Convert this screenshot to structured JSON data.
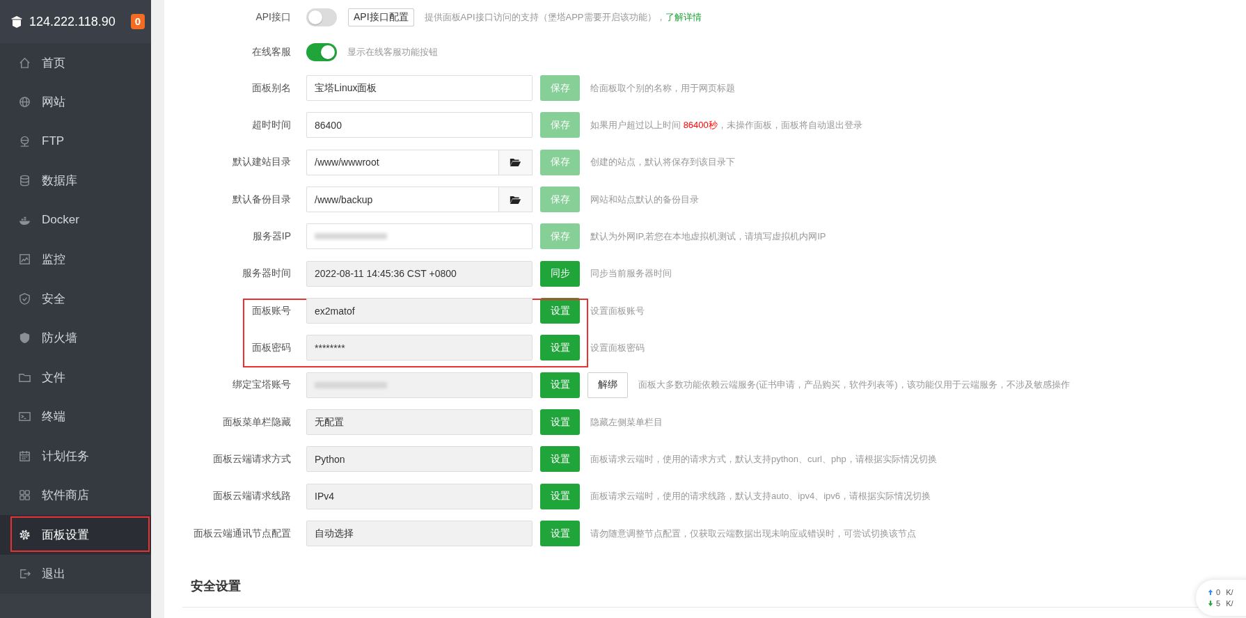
{
  "sidebar": {
    "host": "124.222.118.90",
    "badge": "0",
    "items": [
      {
        "label": "首页",
        "selected": false,
        "highlighted": false
      },
      {
        "label": "网站",
        "selected": false,
        "highlighted": false
      },
      {
        "label": "FTP",
        "selected": false,
        "highlighted": false
      },
      {
        "label": "数据库",
        "selected": false,
        "highlighted": false
      },
      {
        "label": "Docker",
        "selected": false,
        "highlighted": false
      },
      {
        "label": "监控",
        "selected": false,
        "highlighted": false
      },
      {
        "label": "安全",
        "selected": false,
        "highlighted": false
      },
      {
        "label": "防火墙",
        "selected": false,
        "highlighted": false
      },
      {
        "label": "文件",
        "selected": false,
        "highlighted": false
      },
      {
        "label": "终端",
        "selected": false,
        "highlighted": false
      },
      {
        "label": "计划任务",
        "selected": false,
        "highlighted": false
      },
      {
        "label": "软件商店",
        "selected": false,
        "highlighted": false
      },
      {
        "label": "面板设置",
        "selected": true,
        "highlighted": true
      },
      {
        "label": "退出",
        "selected": false,
        "highlighted": false
      }
    ]
  },
  "settings": [
    {
      "kind": "toggle",
      "label": "API接口",
      "on": false,
      "highlighted": false,
      "button": "API接口配置",
      "description": [
        {
          "kind": "text",
          "text": "提供面板API接口访问的支持（堡塔APP需要开启该功能），"
        },
        {
          "kind": "link",
          "text": "了解详情"
        }
      ]
    },
    {
      "kind": "toggle",
      "label": "在线客服",
      "on": true,
      "highlighted": false,
      "description": [
        {
          "kind": "text",
          "text": "显示在线客服功能按钮"
        }
      ]
    },
    {
      "kind": "input",
      "label": "面板别名",
      "value": "宝塔Linux面板",
      "readonly": false,
      "browse": false,
      "redacted": false,
      "highlighted": false,
      "button": {
        "label": "保存",
        "disabled": true
      },
      "description": [
        {
          "kind": "text",
          "text": "给面板取个别的名称，用于网页标题"
        }
      ]
    },
    {
      "kind": "input",
      "label": "超时时间",
      "value": "86400",
      "readonly": false,
      "browse": false,
      "redacted": false,
      "highlighted": false,
      "button": {
        "label": "保存",
        "disabled": true
      },
      "description": [
        {
          "kind": "text",
          "text": "如果用户超过以上时间 "
        },
        {
          "kind": "highlight",
          "text": "86400秒"
        },
        {
          "kind": "text",
          "text": "，未操作面板，面板将自动退出登录"
        }
      ]
    },
    {
      "kind": "input",
      "label": "默认建站目录",
      "value": "/www/wwwroot",
      "readonly": false,
      "browse": true,
      "redacted": false,
      "highlighted": false,
      "button": {
        "label": "保存",
        "disabled": true
      },
      "description": [
        {
          "kind": "text",
          "text": "创建的站点，默认将保存到该目录下"
        }
      ]
    },
    {
      "kind": "input",
      "label": "默认备份目录",
      "value": "/www/backup",
      "readonly": false,
      "browse": true,
      "redacted": false,
      "highlighted": false,
      "button": {
        "label": "保存",
        "disabled": true
      },
      "description": [
        {
          "kind": "text",
          "text": "网站和站点默认的备份目录"
        }
      ]
    },
    {
      "kind": "input",
      "label": "服务器IP",
      "readonly": false,
      "browse": false,
      "redacted": true,
      "highlighted": false,
      "button": {
        "label": "保存",
        "disabled": true
      },
      "description": [
        {
          "kind": "text",
          "text": "默认为外网IP,若您在本地虚拟机测试，请填写虚拟机内网IP"
        }
      ]
    },
    {
      "kind": "input",
      "label": "服务器时间",
      "value": "2022-08-11 14:45:36 CST +0800",
      "readonly": true,
      "browse": false,
      "redacted": false,
      "highlighted": false,
      "button": {
        "label": "同步",
        "disabled": false
      },
      "description": [
        {
          "kind": "text",
          "text": "同步当前服务器时间"
        }
      ]
    },
    {
      "kind": "input",
      "label": "面板账号",
      "value": "ex2matof",
      "readonly": true,
      "browse": false,
      "redacted": false,
      "highlighted": true,
      "button": {
        "label": "设置",
        "disabled": false
      },
      "description": [
        {
          "kind": "text",
          "text": "设置面板账号"
        }
      ]
    },
    {
      "kind": "input",
      "label": "面板密码",
      "value": "********",
      "readonly": true,
      "browse": false,
      "redacted": false,
      "highlighted": true,
      "button": {
        "label": "设置",
        "disabled": false
      },
      "description": [
        {
          "kind": "text",
          "text": "设置面板密码"
        }
      ]
    },
    {
      "kind": "input",
      "label": "绑定宝塔账号",
      "readonly": true,
      "browse": false,
      "redacted": true,
      "highlighted": false,
      "button": {
        "label": "设置",
        "disabled": false
      },
      "extra_button": "解绑",
      "description": [
        {
          "kind": "text",
          "text": "面板大多数功能依赖云端服务(证书申请，产品购买，软件列表等)，该功能仅用于云端服务，不涉及敏感操作"
        }
      ]
    },
    {
      "kind": "input",
      "label": "面板菜单栏隐藏",
      "value": "无配置",
      "readonly": true,
      "browse": false,
      "redacted": false,
      "highlighted": false,
      "button": {
        "label": "设置",
        "disabled": false
      },
      "description": [
        {
          "kind": "text",
          "text": "隐藏左侧菜单栏目"
        }
      ]
    },
    {
      "kind": "input",
      "label": "面板云端请求方式",
      "value": "Python",
      "readonly": true,
      "browse": false,
      "redacted": false,
      "highlighted": false,
      "button": {
        "label": "设置",
        "disabled": false
      },
      "description": [
        {
          "kind": "text",
          "text": "面板请求云端时，使用的请求方式，默认支持python、curl、php，请根据实际情况切换"
        }
      ]
    },
    {
      "kind": "input",
      "label": "面板云端请求线路",
      "value": "IPv4",
      "readonly": true,
      "browse": false,
      "redacted": false,
      "highlighted": false,
      "button": {
        "label": "设置",
        "disabled": false
      },
      "description": [
        {
          "kind": "text",
          "text": "面板请求云端时，使用的请求线路，默认支持auto、ipv4、ipv6，请根据实际情况切换"
        }
      ]
    },
    {
      "kind": "input",
      "label": "面板云端通讯节点配置",
      "value": "自动选择",
      "readonly": true,
      "browse": false,
      "redacted": false,
      "highlighted": false,
      "button": {
        "label": "设置",
        "disabled": false
      },
      "description": [
        {
          "kind": "text",
          "text": "请勿随意调整节点配置，仅获取云端数据出现未响应或错误时，可尝试切换该节点"
        }
      ]
    }
  ],
  "section_title": "安全设置",
  "net_speed": [
    {
      "kind": "up",
      "value": "0",
      "unit": "K/"
    },
    {
      "kind": "down",
      "value": "5",
      "unit": "K/"
    }
  ]
}
